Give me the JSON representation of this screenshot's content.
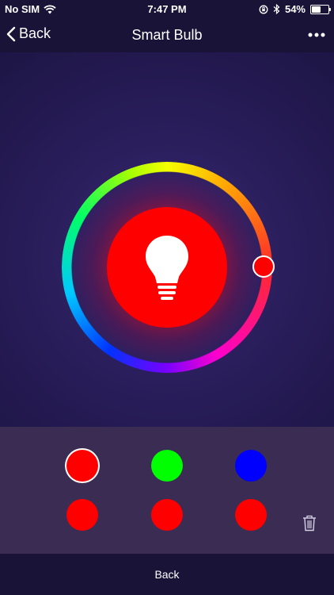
{
  "status_bar": {
    "carrier": "No SIM",
    "time": "7:47 PM",
    "battery": "54%",
    "battery_level": 0.54
  },
  "nav": {
    "back_label": "Back",
    "title": "Smart Bulb",
    "more_icon": "more-dots-icon"
  },
  "bulb": {
    "color": "#ff0000",
    "icon": "lightbulb-icon"
  },
  "presets": {
    "colors": [
      "#ff0000",
      "#00ff00",
      "#0000ff",
      "#ff0000",
      "#ff0000",
      "#ff0000"
    ],
    "selected_index": 0,
    "delete_icon": "trash-icon"
  },
  "bottom": {
    "back_label": "Back"
  }
}
